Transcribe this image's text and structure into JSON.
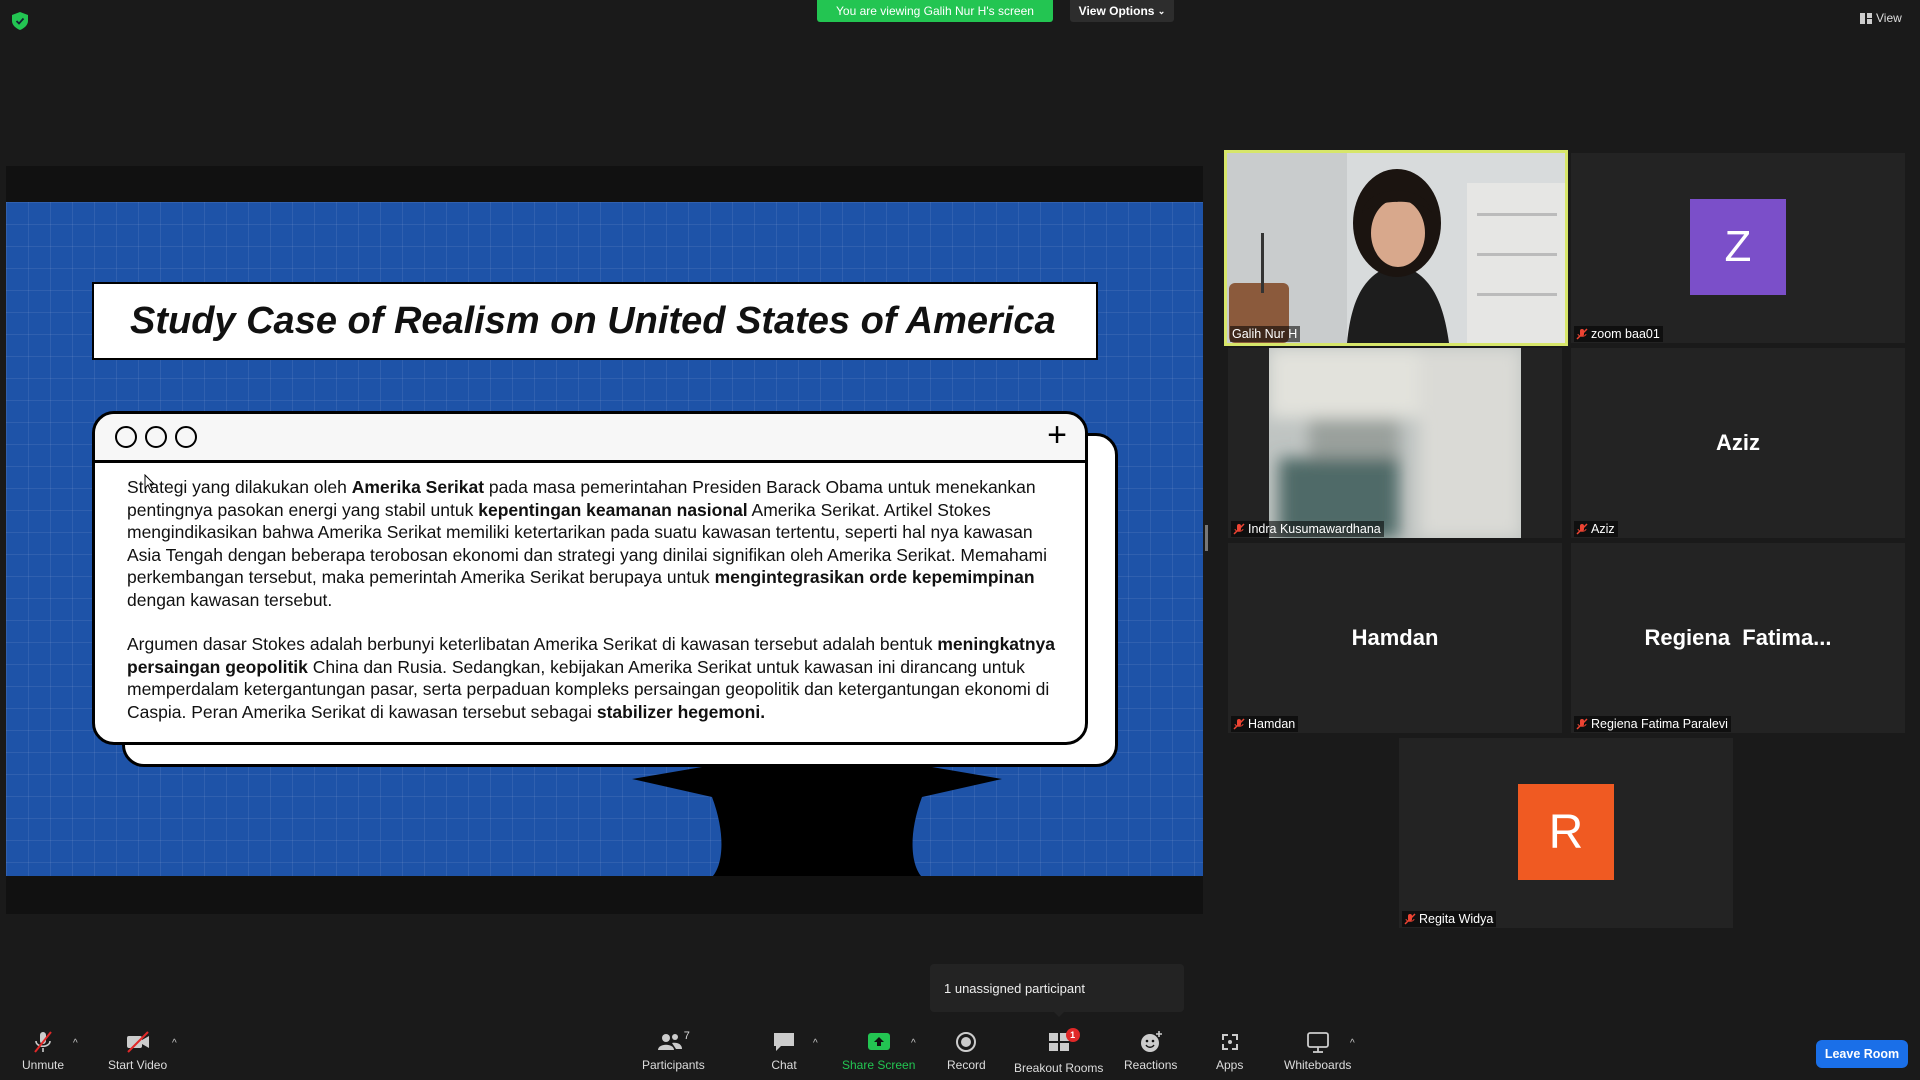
{
  "top": {
    "viewing_banner": "You are viewing Galih Nur H's screen",
    "view_options": "View Options",
    "view_label": "View"
  },
  "slide": {
    "title": "Study Case of Realism on United States of America",
    "para1": [
      {
        "t": "Strategi yang dilakukan oleh "
      },
      {
        "t": "Amerika Serikat",
        "b": true
      },
      {
        "t": " pada masa pemerintahan Presiden Barack Obama untuk menekankan pentingnya pasokan energi yang stabil untuk "
      },
      {
        "t": "kepentingan keamanan nasional",
        "b": true
      },
      {
        "t": " Amerika Serikat. Artikel Stokes mengindikasikan bahwa Amerika Serikat memiliki ketertarikan pada suatu kawasan tertentu, seperti hal nya kawasan Asia Tengah dengan beberapa terobosan ekonomi dan strategi yang dinilai signifikan oleh Amerika Serikat. Memahami perkembangan tersebut, maka pemerintah Amerika Serikat berupaya untuk "
      },
      {
        "t": "mengintegrasikan orde kepemimpinan",
        "b": true
      },
      {
        "t": " dengan kawasan tersebut."
      }
    ],
    "para2": [
      {
        "t": "Argumen dasar Stokes adalah berbunyi keterlibatan Amerika Serikat di kawasan tersebut adalah bentuk "
      },
      {
        "t": "meningkatnya persaingan geopolitik",
        "b": true
      },
      {
        "t": " China dan Rusia. Sedangkan, kebijakan Amerika Serikat untuk kawasan ini dirancang untuk memperdalam ketergantungan pasar, serta perpaduan kompleks persaingan geopolitik dan ketergantungan ekonomi di Caspia. Peran Amerika Serikat di kawasan tersebut sebagai "
      },
      {
        "t": "stabilizer hegemoni.",
        "b": true
      }
    ]
  },
  "participants": {
    "galih": {
      "name": "Galih Nur H"
    },
    "zoom": {
      "name": "zoom baa01",
      "initial": "Z",
      "color": "#7b4fc9"
    },
    "indra": {
      "name": "Indra Kusumawardhana"
    },
    "aziz": {
      "name": "Aziz",
      "display": "Aziz"
    },
    "hamdan": {
      "name": "Hamdan",
      "display": "Hamdan"
    },
    "regiena": {
      "name": "Regiena Fatima Paralevi",
      "display": "Regiena  Fatima..."
    },
    "regita": {
      "name": "Regita Widya",
      "initial": "R",
      "color": "#f05a22"
    }
  },
  "popup": {
    "text": "1 unassigned participant"
  },
  "toolbar": {
    "unmute": "Unmute",
    "start_video": "Start Video",
    "participants": "Participants",
    "participants_count": "7",
    "chat": "Chat",
    "share_screen": "Share Screen",
    "record": "Record",
    "breakout_rooms": "Breakout Rooms",
    "breakout_badge": "1",
    "reactions": "Reactions",
    "apps": "Apps",
    "whiteboards": "Whiteboards",
    "leave_room": "Leave Room"
  }
}
